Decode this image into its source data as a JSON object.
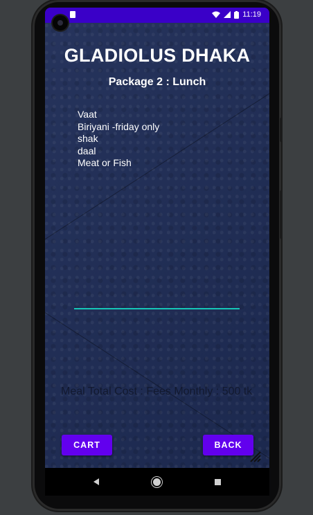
{
  "status_bar": {
    "time": "11:19"
  },
  "app": {
    "title": "GLADIOLUS DHAKA",
    "subtitle": "Package 2 : Lunch",
    "menu_items": [
      "Vaat",
      "Biriyani -friday only",
      "shak",
      "daal",
      "Meat or Fish"
    ],
    "input_value": "",
    "cost_text": "Meal Total Cost : Fees Monthly : 500 tk",
    "buttons": {
      "cart": "CART",
      "back": "BACK"
    }
  },
  "colors": {
    "status_bar": "#3a00c8",
    "background": "#1f2d57",
    "button": "#6200ee",
    "input_underline": "#16c7b8"
  },
  "icons": {
    "status_left": "sd-card-icon",
    "status_right": [
      "wifi-icon",
      "signal-icon",
      "battery-icon"
    ],
    "nav": [
      "nav-back-icon",
      "nav-home-icon",
      "nav-recents-icon"
    ]
  }
}
